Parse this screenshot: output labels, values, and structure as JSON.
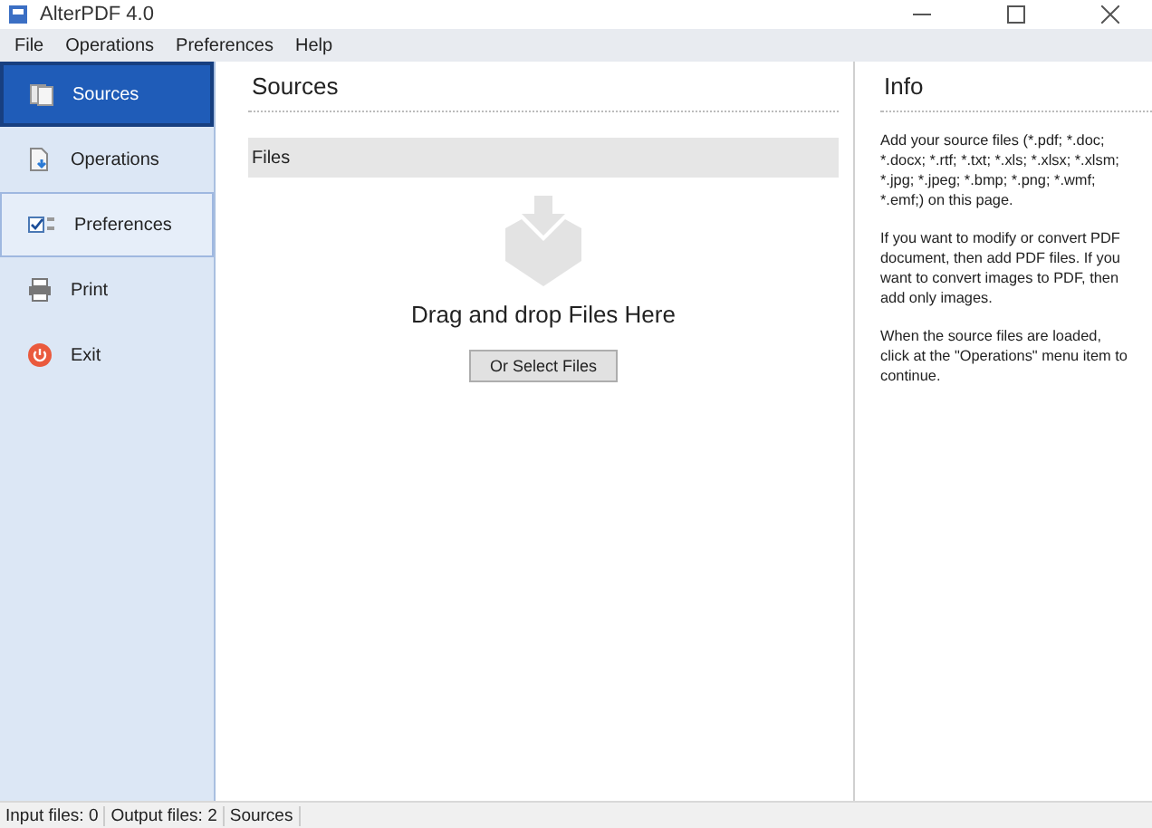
{
  "window": {
    "title": "AlterPDF 4.0"
  },
  "menu": [
    "File",
    "Operations",
    "Preferences",
    "Help"
  ],
  "sidebar": {
    "items": [
      {
        "label": "Sources",
        "kind": "sources",
        "selected": true,
        "hovered": false
      },
      {
        "label": "Operations",
        "kind": "operations",
        "selected": false,
        "hovered": false
      },
      {
        "label": "Preferences",
        "kind": "preferences",
        "selected": false,
        "hovered": true
      },
      {
        "label": "Print",
        "kind": "print",
        "selected": false,
        "hovered": false
      },
      {
        "label": "Exit",
        "kind": "exit",
        "selected": false,
        "hovered": false
      }
    ]
  },
  "main": {
    "heading": "Sources",
    "files_header": "Files",
    "drop_text": "Drag and drop Files Here",
    "select_button": "Or Select Files"
  },
  "info": {
    "heading": "Info",
    "paragraphs": [
      "Add your source files (*.pdf; *.doc; *.docx; *.rtf; *.txt; *.xls; *.xlsx; *.xlsm; *.jpg; *.jpeg; *.bmp; *.png; *.wmf; *.emf;) on this page.",
      "If you want to modify or convert PDF document, then add PDF files. If you want to convert images to PDF, then add only images.",
      "When the source files are loaded, click at the \"Operations\" menu item to continue."
    ]
  },
  "status_bar": [
    "Input files: 0",
    "Output files: 2",
    "Sources"
  ]
}
